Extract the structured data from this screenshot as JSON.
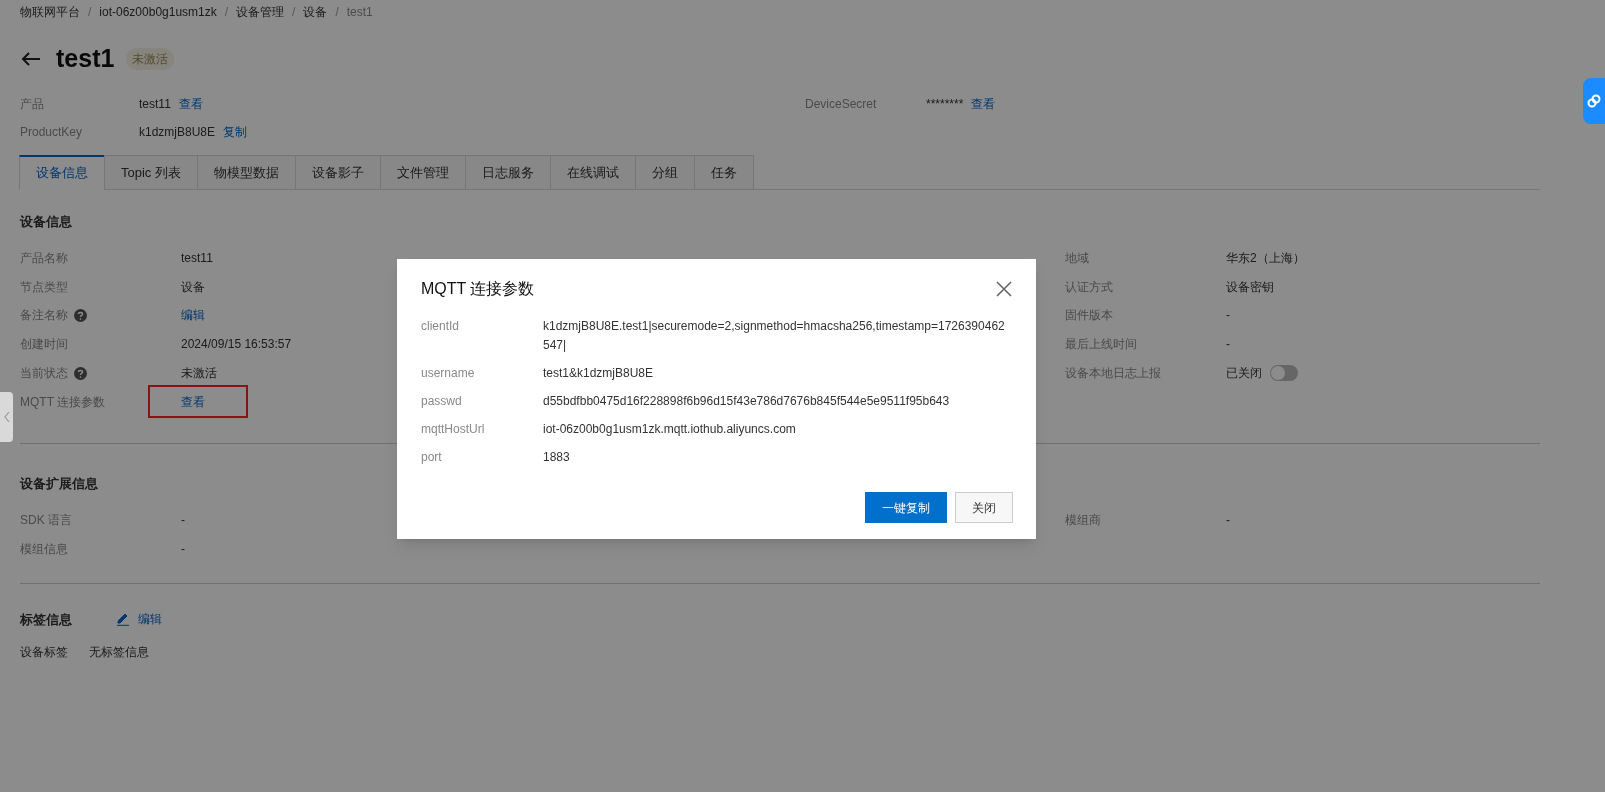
{
  "breadcrumb": {
    "separator": "/",
    "items": [
      "物联网平台",
      "iot-06z00b0g1usm1zk",
      "设备管理",
      "设备",
      "test1"
    ]
  },
  "header": {
    "title": "test1",
    "badge": "未激活"
  },
  "meta": {
    "left": [
      {
        "label": "产品",
        "value": "test11",
        "link": "查看"
      },
      {
        "label": "ProductKey",
        "value": "k1dzmjB8U8E",
        "link": "复制"
      }
    ],
    "right": [
      {
        "label": "DeviceSecret",
        "value": "********",
        "link": "查看"
      }
    ]
  },
  "tabs": [
    {
      "label": "设备信息",
      "selected": true
    },
    {
      "label": "Topic 列表",
      "selected": false
    },
    {
      "label": "物模型数据",
      "selected": false
    },
    {
      "label": "设备影子",
      "selected": false
    },
    {
      "label": "文件管理",
      "selected": false
    },
    {
      "label": "日志服务",
      "selected": false
    },
    {
      "label": "在线调试",
      "selected": false
    },
    {
      "label": "分组",
      "selected": false
    },
    {
      "label": "任务",
      "selected": false
    }
  ],
  "device_info": {
    "title": "设备信息",
    "left": [
      {
        "label": "产品名称",
        "value": "test11"
      },
      {
        "label": "节点类型",
        "value": "设备"
      },
      {
        "label": "备注名称",
        "help": true,
        "link": "编辑"
      },
      {
        "label": "创建时间",
        "value": "2024/09/15 16:53:57"
      },
      {
        "label": "当前状态",
        "help": true,
        "value": "未激活"
      },
      {
        "label": "MQTT 连接参数",
        "link": "查看",
        "highlighted": true
      }
    ],
    "right": [
      {
        "label": "地域",
        "value": "华东2（上海）"
      },
      {
        "label": "认证方式",
        "value": "设备密钥"
      },
      {
        "label": "固件版本",
        "value": "-"
      },
      {
        "label": "最后上线时间",
        "value": "-"
      },
      {
        "label": "设备本地日志上报",
        "value": "已关闭",
        "toggle": {
          "on": false
        }
      }
    ]
  },
  "extended_info": {
    "title": "设备扩展信息",
    "left": [
      {
        "label": "SDK 语言",
        "value": "-"
      },
      {
        "label": "模组信息",
        "value": "-"
      }
    ],
    "right": [
      {
        "label": "模组商",
        "value": "-"
      }
    ]
  },
  "tag_info": {
    "title": "标签信息",
    "edit": "编辑",
    "label": "设备标签",
    "value": "无标签信息"
  },
  "dialog": {
    "title": "MQTT 连接参数",
    "rows": [
      {
        "label": "clientId",
        "value": "k1dzmjB8U8E.test1|securemode=2,signmethod=hmacsha256,timestamp=1726390462547|"
      },
      {
        "label": "username",
        "value": "test1&k1dzmjB8U8E"
      },
      {
        "label": "passwd",
        "value": "d55bdfbb0475d16f228898f6b96d15f43e786d7676b845f544e5e9511f95b643"
      },
      {
        "label": "mqttHostUrl",
        "value": "iot-06z00b0g1usm1zk.mqtt.iothub.aliyuncs.com"
      },
      {
        "label": "port",
        "value": "1883"
      }
    ],
    "buttons": [
      {
        "label": "一键复制",
        "kind": "primary"
      },
      {
        "label": "关闭",
        "kind": "secondary"
      }
    ]
  }
}
